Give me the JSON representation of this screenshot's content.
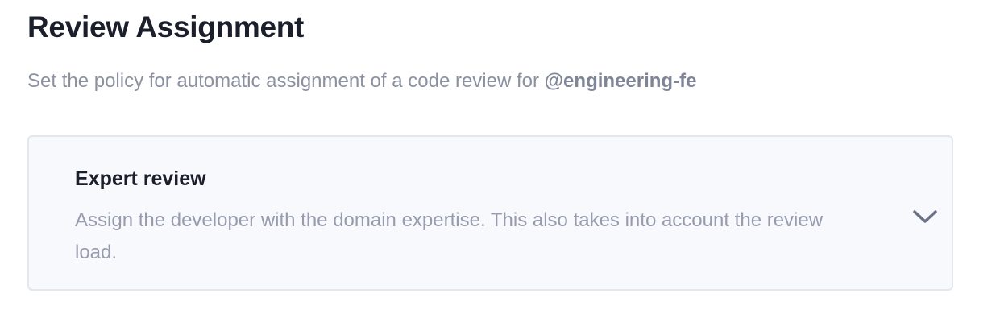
{
  "header": {
    "title": "Review Assignment",
    "subtitle_prefix": "Set the policy for automatic assignment of a code review for ",
    "team_handle": "@engineering-fe"
  },
  "policy_select": {
    "selected_title": "Expert review",
    "selected_description": "Assign the developer with the domain expertise. This also takes into account the review load.",
    "expand_icon": "chevron-down-icon"
  }
}
